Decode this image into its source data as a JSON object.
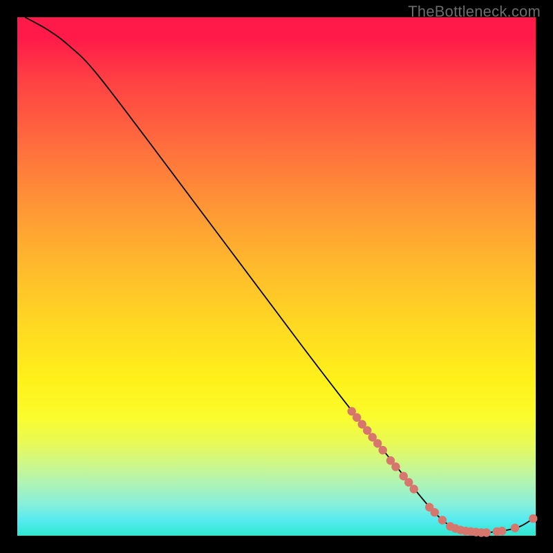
{
  "attribution": "TheBottleneck.com",
  "chart_data": {
    "type": "line",
    "title": "",
    "xlabel": "",
    "ylabel": "",
    "xlim": [
      0,
      100
    ],
    "ylim": [
      0,
      100
    ],
    "curve": [
      {
        "x": 1.5,
        "y": 100
      },
      {
        "x": 6,
        "y": 97.5
      },
      {
        "x": 10,
        "y": 94.5
      },
      {
        "x": 15,
        "y": 89.5
      },
      {
        "x": 25,
        "y": 76.5
      },
      {
        "x": 40,
        "y": 56.5
      },
      {
        "x": 55,
        "y": 36.5
      },
      {
        "x": 65,
        "y": 23.5
      },
      {
        "x": 73,
        "y": 13.5
      },
      {
        "x": 80,
        "y": 5.0
      },
      {
        "x": 84,
        "y": 1.6
      },
      {
        "x": 87,
        "y": 0.8
      },
      {
        "x": 90,
        "y": 0.6
      },
      {
        "x": 94,
        "y": 1.0
      },
      {
        "x": 97,
        "y": 1.8
      },
      {
        "x": 99.5,
        "y": 3.3
      }
    ],
    "markers": [
      {
        "x": 64.5,
        "y": 24.0
      },
      {
        "x": 65.5,
        "y": 22.8
      },
      {
        "x": 66.5,
        "y": 21.5
      },
      {
        "x": 67.5,
        "y": 20.3
      },
      {
        "x": 68.5,
        "y": 19.0
      },
      {
        "x": 69.5,
        "y": 17.8
      },
      {
        "x": 70.5,
        "y": 16.5
      },
      {
        "x": 72.0,
        "y": 14.5
      },
      {
        "x": 73.0,
        "y": 13.3
      },
      {
        "x": 74.5,
        "y": 11.5
      },
      {
        "x": 75.5,
        "y": 10.3
      },
      {
        "x": 76.5,
        "y": 9.0
      },
      {
        "x": 79.5,
        "y": 5.5
      },
      {
        "x": 80.5,
        "y": 4.5
      },
      {
        "x": 82.0,
        "y": 3.0
      },
      {
        "x": 83.5,
        "y": 1.8
      },
      {
        "x": 84.5,
        "y": 1.4
      },
      {
        "x": 85.5,
        "y": 1.1
      },
      {
        "x": 86.5,
        "y": 0.9
      },
      {
        "x": 87.5,
        "y": 0.8
      },
      {
        "x": 88.5,
        "y": 0.7
      },
      {
        "x": 89.5,
        "y": 0.6
      },
      {
        "x": 90.5,
        "y": 0.6
      },
      {
        "x": 92.5,
        "y": 0.8
      },
      {
        "x": 93.5,
        "y": 0.9
      },
      {
        "x": 96.0,
        "y": 1.5
      },
      {
        "x": 99.5,
        "y": 3.3
      }
    ],
    "colors": {
      "curve": "#000000",
      "markers": "#d7766c"
    }
  }
}
